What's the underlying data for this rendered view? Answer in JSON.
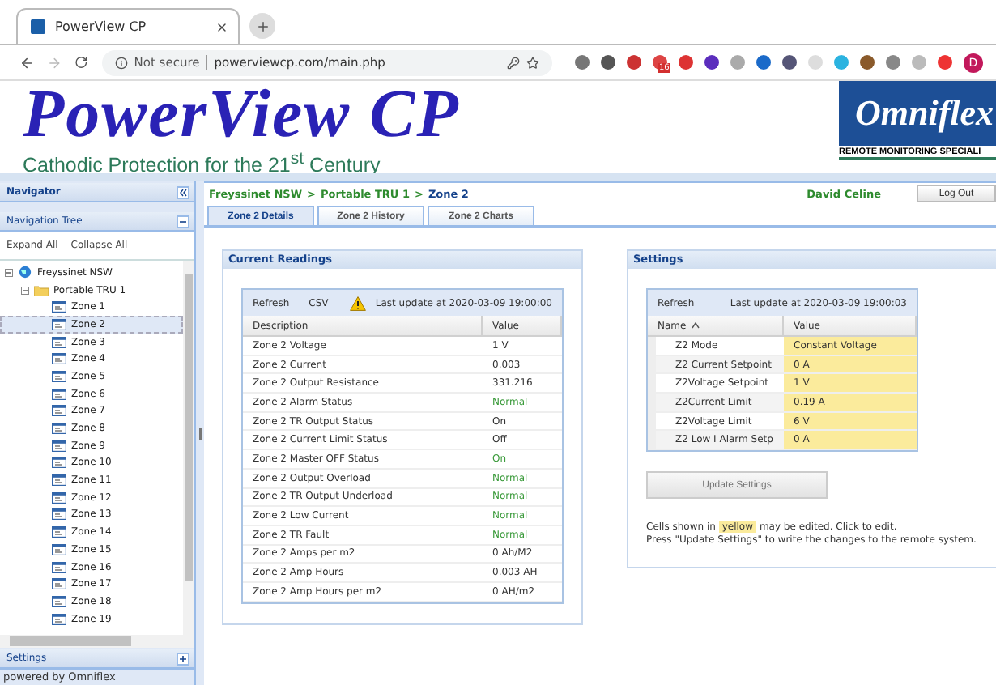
{
  "browser": {
    "tab_title": "PowerView CP",
    "security": "Not secure",
    "url": "powerviewcp.com/main.php",
    "extension_badge": "16",
    "profile_initial": "D"
  },
  "header": {
    "logo": "PowerView CP",
    "tagline": "Cathodic Protection for the 21$^{st}$ Century",
    "partner_logo": "Omniflex",
    "partner_caption": "REMOTE MONITORING SPECIALI"
  },
  "sidebar": {
    "title": "Navigator",
    "tree_title": "Navigation Tree",
    "actions": [
      "Expand All",
      "Collapse All"
    ],
    "tree": [
      {
        "label": "Freyssinet NSW",
        "kind": "site",
        "selected": false,
        "expanded": true,
        "children": [
          {
            "label": "Portable TRU 1",
            "kind": "folder",
            "selected": false,
            "expanded": true,
            "children": [
              {
                "label": "Zone 1",
                "kind": "zone",
                "selected": false
              },
              {
                "label": "Zone 2",
                "kind": "zone",
                "selected": true
              },
              {
                "label": "Zone 3",
                "kind": "zone",
                "selected": false
              },
              {
                "label": "Zone 4",
                "kind": "zone",
                "selected": false
              },
              {
                "label": "Zone 5",
                "kind": "zone",
                "selected": false
              },
              {
                "label": "Zone 6",
                "kind": "zone",
                "selected": false
              },
              {
                "label": "Zone 7",
                "kind": "zone",
                "selected": false
              },
              {
                "label": "Zone 8",
                "kind": "zone",
                "selected": false
              },
              {
                "label": "Zone 9",
                "kind": "zone",
                "selected": false
              },
              {
                "label": "Zone 10",
                "kind": "zone",
                "selected": false
              },
              {
                "label": "Zone 11",
                "kind": "zone",
                "selected": false
              },
              {
                "label": "Zone 12",
                "kind": "zone",
                "selected": false
              },
              {
                "label": "Zone 13",
                "kind": "zone",
                "selected": false
              },
              {
                "label": "Zone 14",
                "kind": "zone",
                "selected": false
              },
              {
                "label": "Zone 15",
                "kind": "zone",
                "selected": false
              },
              {
                "label": "Zone 16",
                "kind": "zone",
                "selected": false
              },
              {
                "label": "Zone 17",
                "kind": "zone",
                "selected": false
              },
              {
                "label": "Zone 18",
                "kind": "zone",
                "selected": false
              },
              {
                "label": "Zone 19",
                "kind": "zone",
                "selected": false
              }
            ]
          }
        ]
      }
    ],
    "settings_title": "Settings"
  },
  "breadcrumb": [
    "Freyssinet NSW",
    "Portable TRU 1",
    "Zone 2"
  ],
  "breadcrumb_separator": ">",
  "user": "David Celine",
  "logout": "Log Out",
  "tabs": [
    {
      "label": "Zone 2 Details",
      "selected": true
    },
    {
      "label": "Zone 2 History",
      "selected": false
    },
    {
      "label": "Zone 2 Charts",
      "selected": false
    }
  ],
  "readings": {
    "title": "Current Readings",
    "tools": [
      "Refresh",
      "CSV"
    ],
    "last_update": "Last update at 2020-03-09 19:00:00",
    "columns": [
      "Description",
      "Value"
    ],
    "rows": [
      {
        "description": "Zone 2 Voltage",
        "value": "1 V",
        "good": false
      },
      {
        "description": "Zone 2 Current",
        "value": "0.003",
        "good": false
      },
      {
        "description": "Zone 2 Output Resistance",
        "value": "331.216",
        "good": false
      },
      {
        "description": "Zone 2 Alarm Status",
        "value": "Normal",
        "good": true
      },
      {
        "description": "Zone 2 TR Output Status",
        "value": "On",
        "good": false
      },
      {
        "description": "Zone 2 Current Limit Status",
        "value": "Off",
        "good": false
      },
      {
        "description": "Zone 2 Master OFF Status",
        "value": "On",
        "good": true
      },
      {
        "description": "Zone 2 Output Overload",
        "value": "Normal",
        "good": true
      },
      {
        "description": "Zone 2 TR Output Underload",
        "value": "Normal",
        "good": true
      },
      {
        "description": "Zone 2 Low Current",
        "value": "Normal",
        "good": true
      },
      {
        "description": "Zone 2 TR Fault",
        "value": "Normal",
        "good": true
      },
      {
        "description": "Zone 2 Amps per m2",
        "value": "0 Ah/M2",
        "good": false
      },
      {
        "description": "Zone 2 Amp Hours",
        "value": "0.003 AH",
        "good": false
      },
      {
        "description": "Zone 2 Amp Hours per m2",
        "value": "0 AH/m2",
        "good": false
      }
    ]
  },
  "settings": {
    "title": "Settings",
    "tool": "Refresh",
    "last_update": "Last update at 2020-03-09 19:00:03",
    "columns": [
      "Name",
      "Value"
    ],
    "rows": [
      {
        "name": "Z2 Mode",
        "value": "Constant Voltage",
        "editable": true
      },
      {
        "name": "Z2 Current Setpoint",
        "value": "0 A",
        "editable": true
      },
      {
        "name": "Z2Voltage Setpoint",
        "value": "1 V",
        "editable": true
      },
      {
        "name": "Z2Current Limit",
        "value": "0.19 A",
        "editable": true
      },
      {
        "name": "Z2Voltage Limit",
        "value": "6 V",
        "editable": true
      },
      {
        "name": "Z2 Low I Alarm Setp",
        "value": "0 A",
        "editable": true
      }
    ],
    "button": "Update Settings",
    "note": {
      "before": "Cells shown in",
      "highlight": "yellow",
      "after": "may be edited. Click to edit.",
      "line2": "Press \"Update Settings\" to write the changes to the remote system."
    }
  },
  "footer": "powered by Omniflex"
}
